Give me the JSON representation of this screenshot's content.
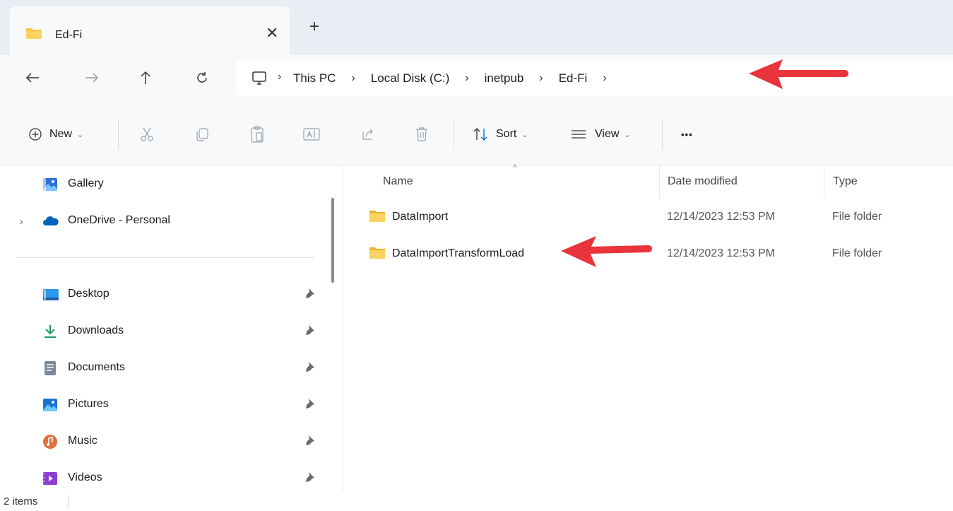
{
  "window": {
    "tab_title": "Ed-Fi",
    "close_glyph": "✕",
    "add_glyph": "+"
  },
  "nav": {
    "back_icon": "back-arrow-icon",
    "forward_icon": "forward-arrow-icon",
    "up_icon": "up-arrow-icon",
    "refresh_icon": "refresh-icon"
  },
  "address": {
    "root_icon": "this-pc-icon",
    "crumbs": [
      "This PC",
      "Local Disk (C:)",
      "inetpub",
      "Ed-Fi"
    ],
    "separator": "›"
  },
  "toolbar": {
    "new_label": "New",
    "sort_label": "Sort",
    "view_label": "View",
    "more_label": "•••",
    "chevron": "⌄"
  },
  "sidebar": {
    "items": [
      {
        "label": "Gallery",
        "icon": "gallery-icon"
      },
      {
        "label": "OneDrive - Personal",
        "icon": "onedrive-cloud-icon"
      },
      {
        "label": "Desktop",
        "icon": "desktop-icon"
      },
      {
        "label": "Downloads",
        "icon": "download-icon"
      },
      {
        "label": "Documents",
        "icon": "documents-icon"
      },
      {
        "label": "Pictures",
        "icon": "pictures-icon"
      },
      {
        "label": "Music",
        "icon": "music-icon"
      },
      {
        "label": "Videos",
        "icon": "videos-icon"
      }
    ],
    "expander": "›"
  },
  "table": {
    "columns": [
      "Name",
      "Date modified",
      "Type"
    ],
    "sort_caret": "^",
    "rows": [
      {
        "name": "DataImport",
        "date": "12/14/2023 12:53 PM",
        "type": "File folder"
      },
      {
        "name": "DataImportTransformLoad",
        "date": "12/14/2023 12:53 PM",
        "type": "File folder"
      }
    ]
  },
  "status": {
    "item_count": "2 items"
  },
  "colors": {
    "accent": "#0067c0",
    "folder_yellow": "#f8c444",
    "annotation_red": "#e8343a"
  }
}
